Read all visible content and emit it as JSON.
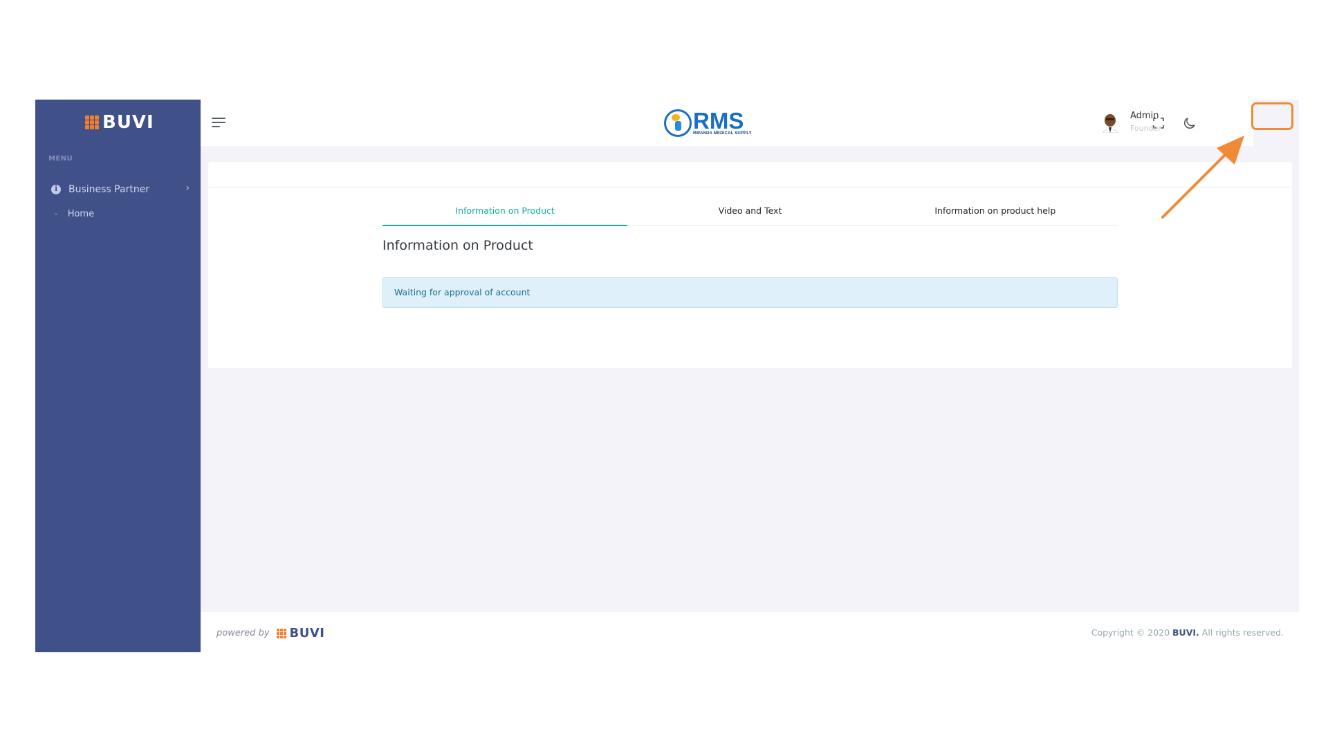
{
  "sidebar": {
    "brand": "BUVI",
    "menu_title": "MENU",
    "items": [
      {
        "label": "Business Partner",
        "icon": "info-circle-icon"
      }
    ],
    "sub_items": [
      {
        "label": "Home"
      }
    ]
  },
  "topbar": {
    "logo_text": "RMS",
    "logo_subtext": "RWANDA MEDICAL SUPPLY",
    "user_name": "Admin",
    "user_role": "Founder"
  },
  "main": {
    "tabs": [
      {
        "label": "Information on Product",
        "active": true
      },
      {
        "label": "Video and Text",
        "active": false
      },
      {
        "label": "Information on product help",
        "active": false
      }
    ],
    "title": "Information on Product",
    "alert": "Waiting for approval of account"
  },
  "footer": {
    "powered_by": "powered by",
    "brand": "BUVI",
    "copyright_prefix": "Copyright © 2020 ",
    "copyright_brand": "BUVI.",
    "copyright_suffix": " All rights reserved."
  },
  "colors": {
    "sidebar": "#405189",
    "accent_tab": "#0ab39c",
    "brand_orange": "#f47e2d",
    "annotation": "#f08a37",
    "alert_bg": "#dff0fa"
  }
}
